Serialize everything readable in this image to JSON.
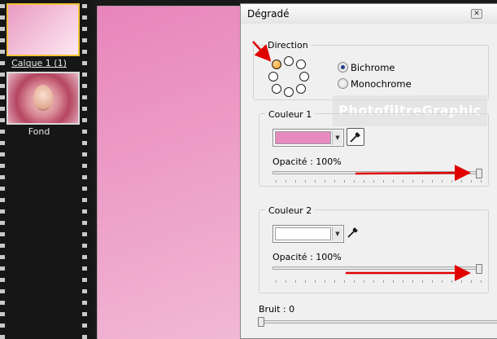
{
  "layers": {
    "items": [
      {
        "label": "Calque 1 (1)",
        "selected": true
      },
      {
        "label": "Fond",
        "selected": false
      }
    ]
  },
  "dialog": {
    "title": "Dégradé",
    "close_icon": "close-icon",
    "direction": {
      "label": "Direction",
      "selected_dot": "top-left"
    },
    "mode": {
      "options": [
        "Bichrome",
        "Monochrome"
      ],
      "selected": "Bichrome"
    },
    "watermark": "PhotofiltreGraphic",
    "couleur1": {
      "label": "Couleur 1",
      "color": "#e78ac0",
      "opacity_label": "Opacité : 100%",
      "opacity": 100
    },
    "couleur2": {
      "label": "Couleur 2",
      "color": "#ffffff",
      "opacity_label": "Opacité : 100%",
      "opacity": 100
    },
    "bruit": {
      "label": "Bruit : 0",
      "value": 0
    }
  },
  "colors": {
    "canvas_gradient_start": "#e885bb",
    "canvas_gradient_end": "#f2b8d6",
    "annotation_arrow": "#e00000",
    "selection_border": "#f2c23a"
  }
}
